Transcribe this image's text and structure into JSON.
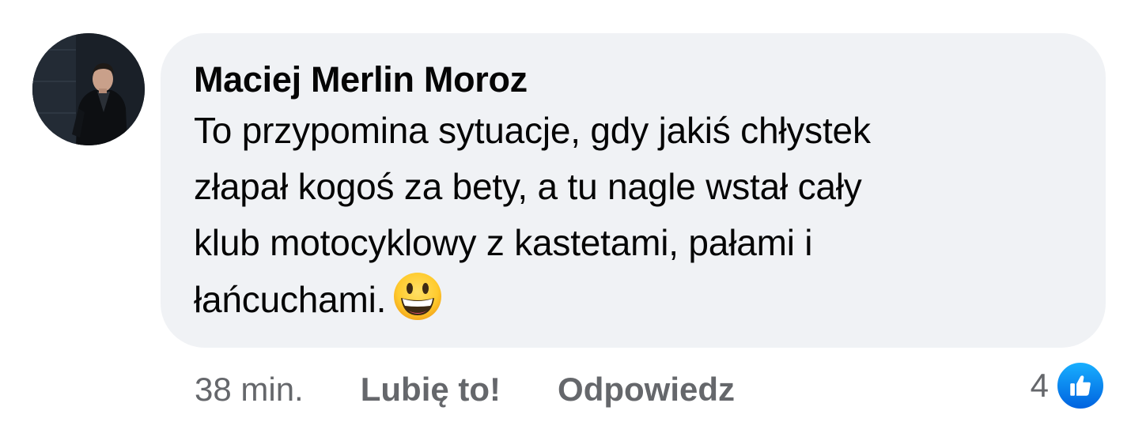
{
  "comment": {
    "author": "Maciej Merlin Moroz",
    "text_lines": [
      "To przypomina sytuacje, gdy jakiś chłystek",
      "złapał kogoś za bety, a tu nagle wstał cały",
      "klub motocyklowy z kastetami, pałami i",
      "łańcuchami."
    ],
    "emoji": "grinning-face-emoji",
    "time": "38 min.",
    "like_label": "Lubię to!",
    "reply_label": "Odpowiedz",
    "reaction_count": "4",
    "reaction_icon": "like-icon",
    "colors": {
      "bubble": "#f0f2f5",
      "meta_text": "#65676b",
      "like_blue": "#1877f2"
    }
  }
}
